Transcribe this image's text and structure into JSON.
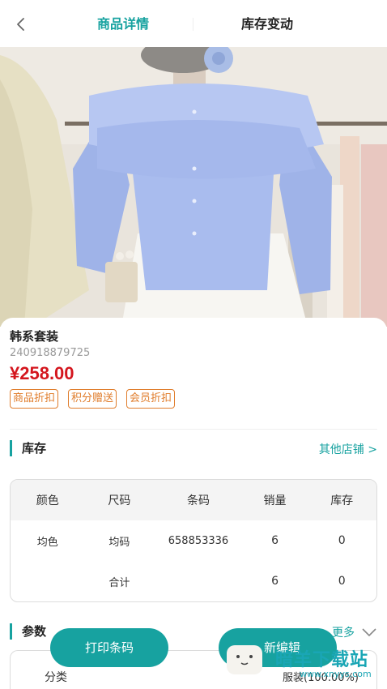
{
  "topbar": {
    "tab_detail": "商品详情",
    "tab_stock_change": "库存变动"
  },
  "product": {
    "name": "韩系套装",
    "code": "240918879725",
    "price": "¥258.00",
    "tags": [
      "商品折扣",
      "积分赠送",
      "会员折扣"
    ]
  },
  "stock": {
    "title": "库存",
    "more_stores": "其他店铺 >",
    "columns": [
      "颜色",
      "尺码",
      "条码",
      "销量",
      "库存"
    ],
    "rows": [
      [
        "均色",
        "均码",
        "658853336",
        "6",
        "0"
      ]
    ],
    "total": {
      "label": "合计",
      "sales": "6",
      "stock": "0"
    }
  },
  "params": {
    "title": "参数",
    "more": "更多",
    "category_label": "分类",
    "category_value": "服装(100.00%)"
  },
  "actions": {
    "print_barcode": "打印条码",
    "edit": "新编辑"
  },
  "watermark": {
    "text": "暗羊下载站",
    "url": "www.xnyys.com"
  },
  "colors": {
    "accent": "#17a2a0",
    "price": "#d4161e",
    "tag": "#e07d2c"
  }
}
